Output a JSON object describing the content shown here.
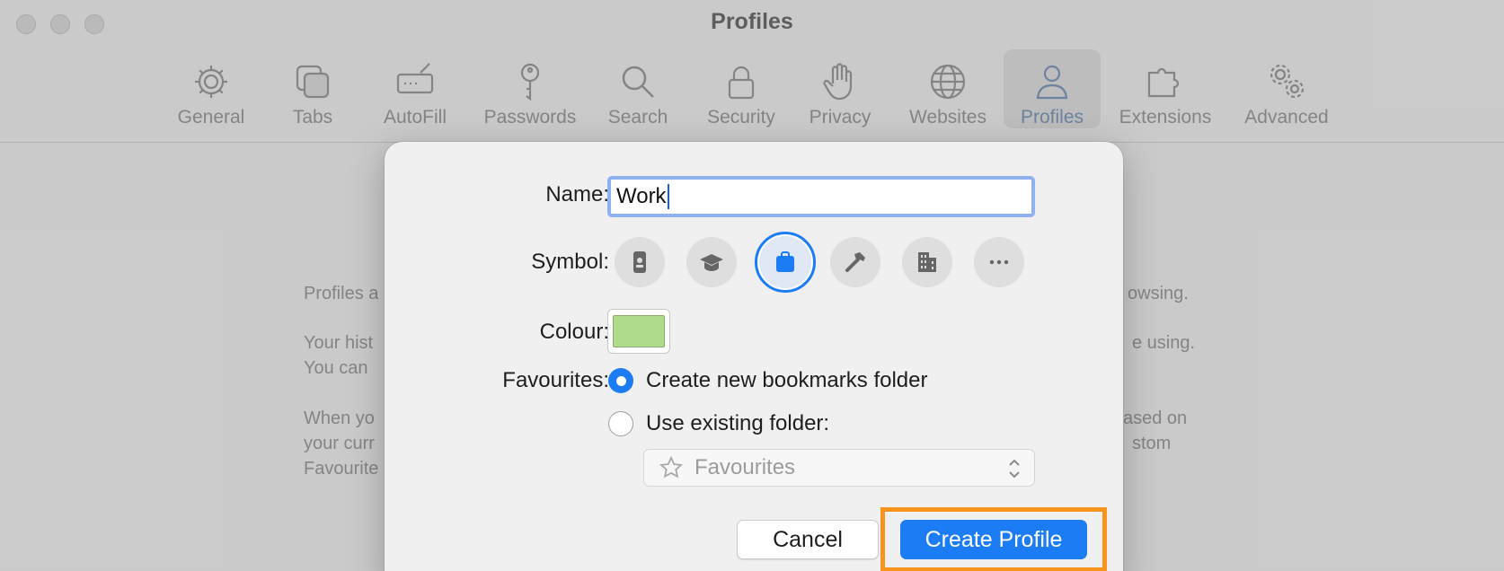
{
  "window": {
    "title": "Profiles"
  },
  "toolbar": {
    "items": [
      {
        "label": "General",
        "icon": "gear-icon"
      },
      {
        "label": "Tabs",
        "icon": "tabs-icon"
      },
      {
        "label": "AutoFill",
        "icon": "autofill-icon"
      },
      {
        "label": "Passwords",
        "icon": "key-icon"
      },
      {
        "label": "Search",
        "icon": "search-icon"
      },
      {
        "label": "Security",
        "icon": "lock-icon"
      },
      {
        "label": "Privacy",
        "icon": "hand-icon"
      },
      {
        "label": "Websites",
        "icon": "globe-icon"
      },
      {
        "label": "Profiles",
        "icon": "person-icon",
        "active": true
      },
      {
        "label": "Extensions",
        "icon": "puzzle-icon"
      },
      {
        "label": "Advanced",
        "icon": "gears-icon"
      }
    ]
  },
  "background": {
    "left_lines": [
      "Profiles a",
      "Your hist",
      "You can",
      "When yo",
      "your curr",
      "Favourite"
    ],
    "right_lines": [
      "owsing.",
      "e using.",
      "ased on",
      "stom"
    ]
  },
  "dialog": {
    "name_label": "Name:",
    "name_value": "Work",
    "symbol_label": "Symbol:",
    "symbols": [
      "id-badge-icon",
      "graduation-cap-icon",
      "briefcase-icon",
      "hammer-icon",
      "building-icon",
      "more-icon"
    ],
    "selected_symbol": "briefcase-icon",
    "colour_label": "Colour:",
    "colour_value": "#aedc8c",
    "favourites_label": "Favourites:",
    "option_new": "Create new bookmarks folder",
    "option_existing": "Use existing folder:",
    "selected_option": "new",
    "folder_select_value": "Favourites",
    "cancel_label": "Cancel",
    "create_label": "Create Profile"
  },
  "colors": {
    "accent": "#1b7cf3",
    "highlight": "#f7941d"
  }
}
